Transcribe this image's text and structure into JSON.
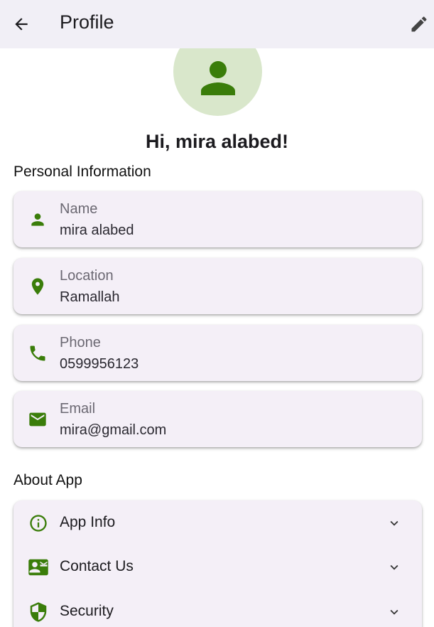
{
  "appbar": {
    "title": "Profile",
    "back_icon": "arrow-back-icon",
    "edit_icon": "pencil-edit-icon"
  },
  "profile": {
    "avatar_icon": "person-icon",
    "greeting": "Hi, mira alabed!"
  },
  "personal_information": {
    "title": "Personal Information",
    "items": [
      {
        "icon": "person-icon",
        "label": "Name",
        "value": "mira alabed"
      },
      {
        "icon": "location-pin-icon",
        "label": "Location",
        "value": "Ramallah"
      },
      {
        "icon": "phone-icon",
        "label": "Phone",
        "value": "0599956123"
      },
      {
        "icon": "email-icon",
        "label": "Email",
        "value": "mira@gmail.com"
      }
    ]
  },
  "about_app": {
    "title": "About App",
    "items": [
      {
        "icon": "info-circle-icon",
        "label": "App Info",
        "expand_icon": "chevron-down-icon"
      },
      {
        "icon": "contact-card-icon",
        "label": "Contact Us",
        "expand_icon": "chevron-down-icon"
      },
      {
        "icon": "security-shield-icon",
        "label": "Security",
        "expand_icon": "chevron-down-icon"
      }
    ]
  },
  "colors": {
    "accent_green": "#3a7d0a",
    "appbar_bg": "#f1eff6",
    "card_bg": "#f4eff7",
    "avatar_bg": "#d9e7cb"
  }
}
